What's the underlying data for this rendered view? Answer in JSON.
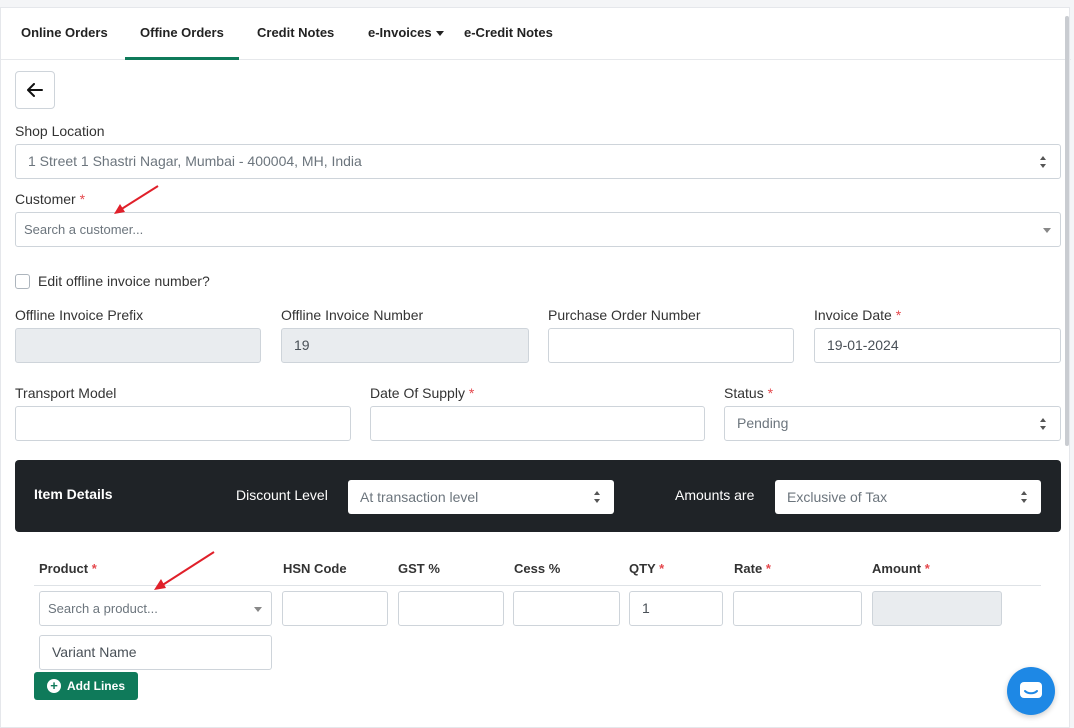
{
  "tabs": [
    {
      "label": "Online Orders"
    },
    {
      "label": "Offine Orders"
    },
    {
      "label": "Credit Notes"
    },
    {
      "label": "e-Invoices"
    },
    {
      "label": "e-Credit Notes"
    }
  ],
  "form": {
    "shop_location_label": "Shop Location",
    "shop_location_value": "1 Street 1 Shastri Nagar, Mumbai - 400004, MH, India",
    "customer_label": "Customer",
    "customer_placeholder": "Search a customer...",
    "edit_invoice_label": "Edit offline invoice number?",
    "prefix_label": "Offline Invoice Prefix",
    "prefix_value": "",
    "invoice_number_label": "Offline Invoice Number",
    "invoice_number_value": "19",
    "po_label": "Purchase Order Number",
    "po_value": "",
    "invoice_date_label": "Invoice Date",
    "invoice_date_value": "19-01-2024",
    "transport_label": "Transport Model",
    "supply_date_label": "Date Of Supply",
    "status_label": "Status",
    "status_value": "Pending",
    "required_mark": "*"
  },
  "item_details": {
    "title": "Item Details",
    "discount_label": "Discount Level",
    "discount_value": "At transaction level",
    "amounts_label": "Amounts are",
    "amounts_value": "Exclusive of Tax"
  },
  "table": {
    "headers": {
      "product": "Product",
      "hsn": "HSN Code",
      "gst": "GST %",
      "cess": "Cess %",
      "qty": "QTY",
      "rate": "Rate",
      "amount": "Amount"
    },
    "product_placeholder": "Search a product...",
    "qty_value": "1",
    "variant_placeholder": "Variant Name"
  },
  "add_lines_label": "Add Lines",
  "colors": {
    "accent": "#0f7a5a",
    "dark_bar": "#1f2327",
    "arrow": "#e0202a",
    "chat": "#1e88e5"
  },
  "icons": [
    "back-arrow-icon",
    "plus-circle-icon",
    "chat-icon",
    "chevron-down-icon"
  ]
}
